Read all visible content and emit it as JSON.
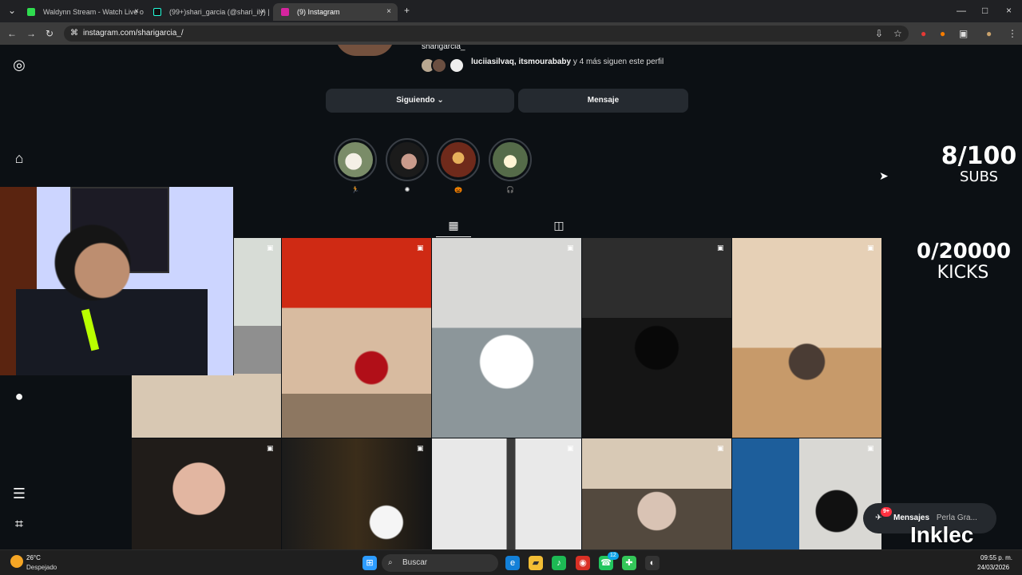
{
  "browser": {
    "tabs": [
      {
        "label": "Waldynn Stream - Watch Live o",
        "close": "×",
        "color": "#2fdc4f"
      },
      {
        "label": "(99+)shari_garcia (@shari_ily) |",
        "close": "×",
        "color": "#000000"
      },
      {
        "label": "(9) Instagram",
        "close": "×",
        "color": "#d6249f"
      }
    ],
    "new_tab": "+",
    "url": "instagram.com/sharigarcia_/",
    "window_controls": [
      "—",
      "□",
      "×"
    ]
  },
  "instagram": {
    "handle": "sharigarcia_",
    "followers_text": "luciiasilvaq, itsmourababy",
    "followers_suffix": " y 4 más siguen este perfil",
    "buttons": {
      "following": "Siguiendo ⌄",
      "message": "Mensaje"
    },
    "highlights": [
      "🏃",
      "✺",
      "🎃",
      "🎧"
    ],
    "tab_grid_icon": "▦",
    "tab_tagged_icon": "◫",
    "messages_label": "Mensajes",
    "messages_badge": "9+",
    "messages_preview": "Perla Gra..."
  },
  "stream_overlay": {
    "subs_count": "8/100",
    "subs_label": "SUBS",
    "kicks_count": "0/20000",
    "kicks_label": "KICKS",
    "watermark": "Inklec"
  },
  "taskbar": {
    "weather_temp": "26°C",
    "weather_desc": "Despejado",
    "search": "Buscar",
    "time": "09:55 p. m.",
    "date": "24/03/2026",
    "badge_count": "12"
  }
}
